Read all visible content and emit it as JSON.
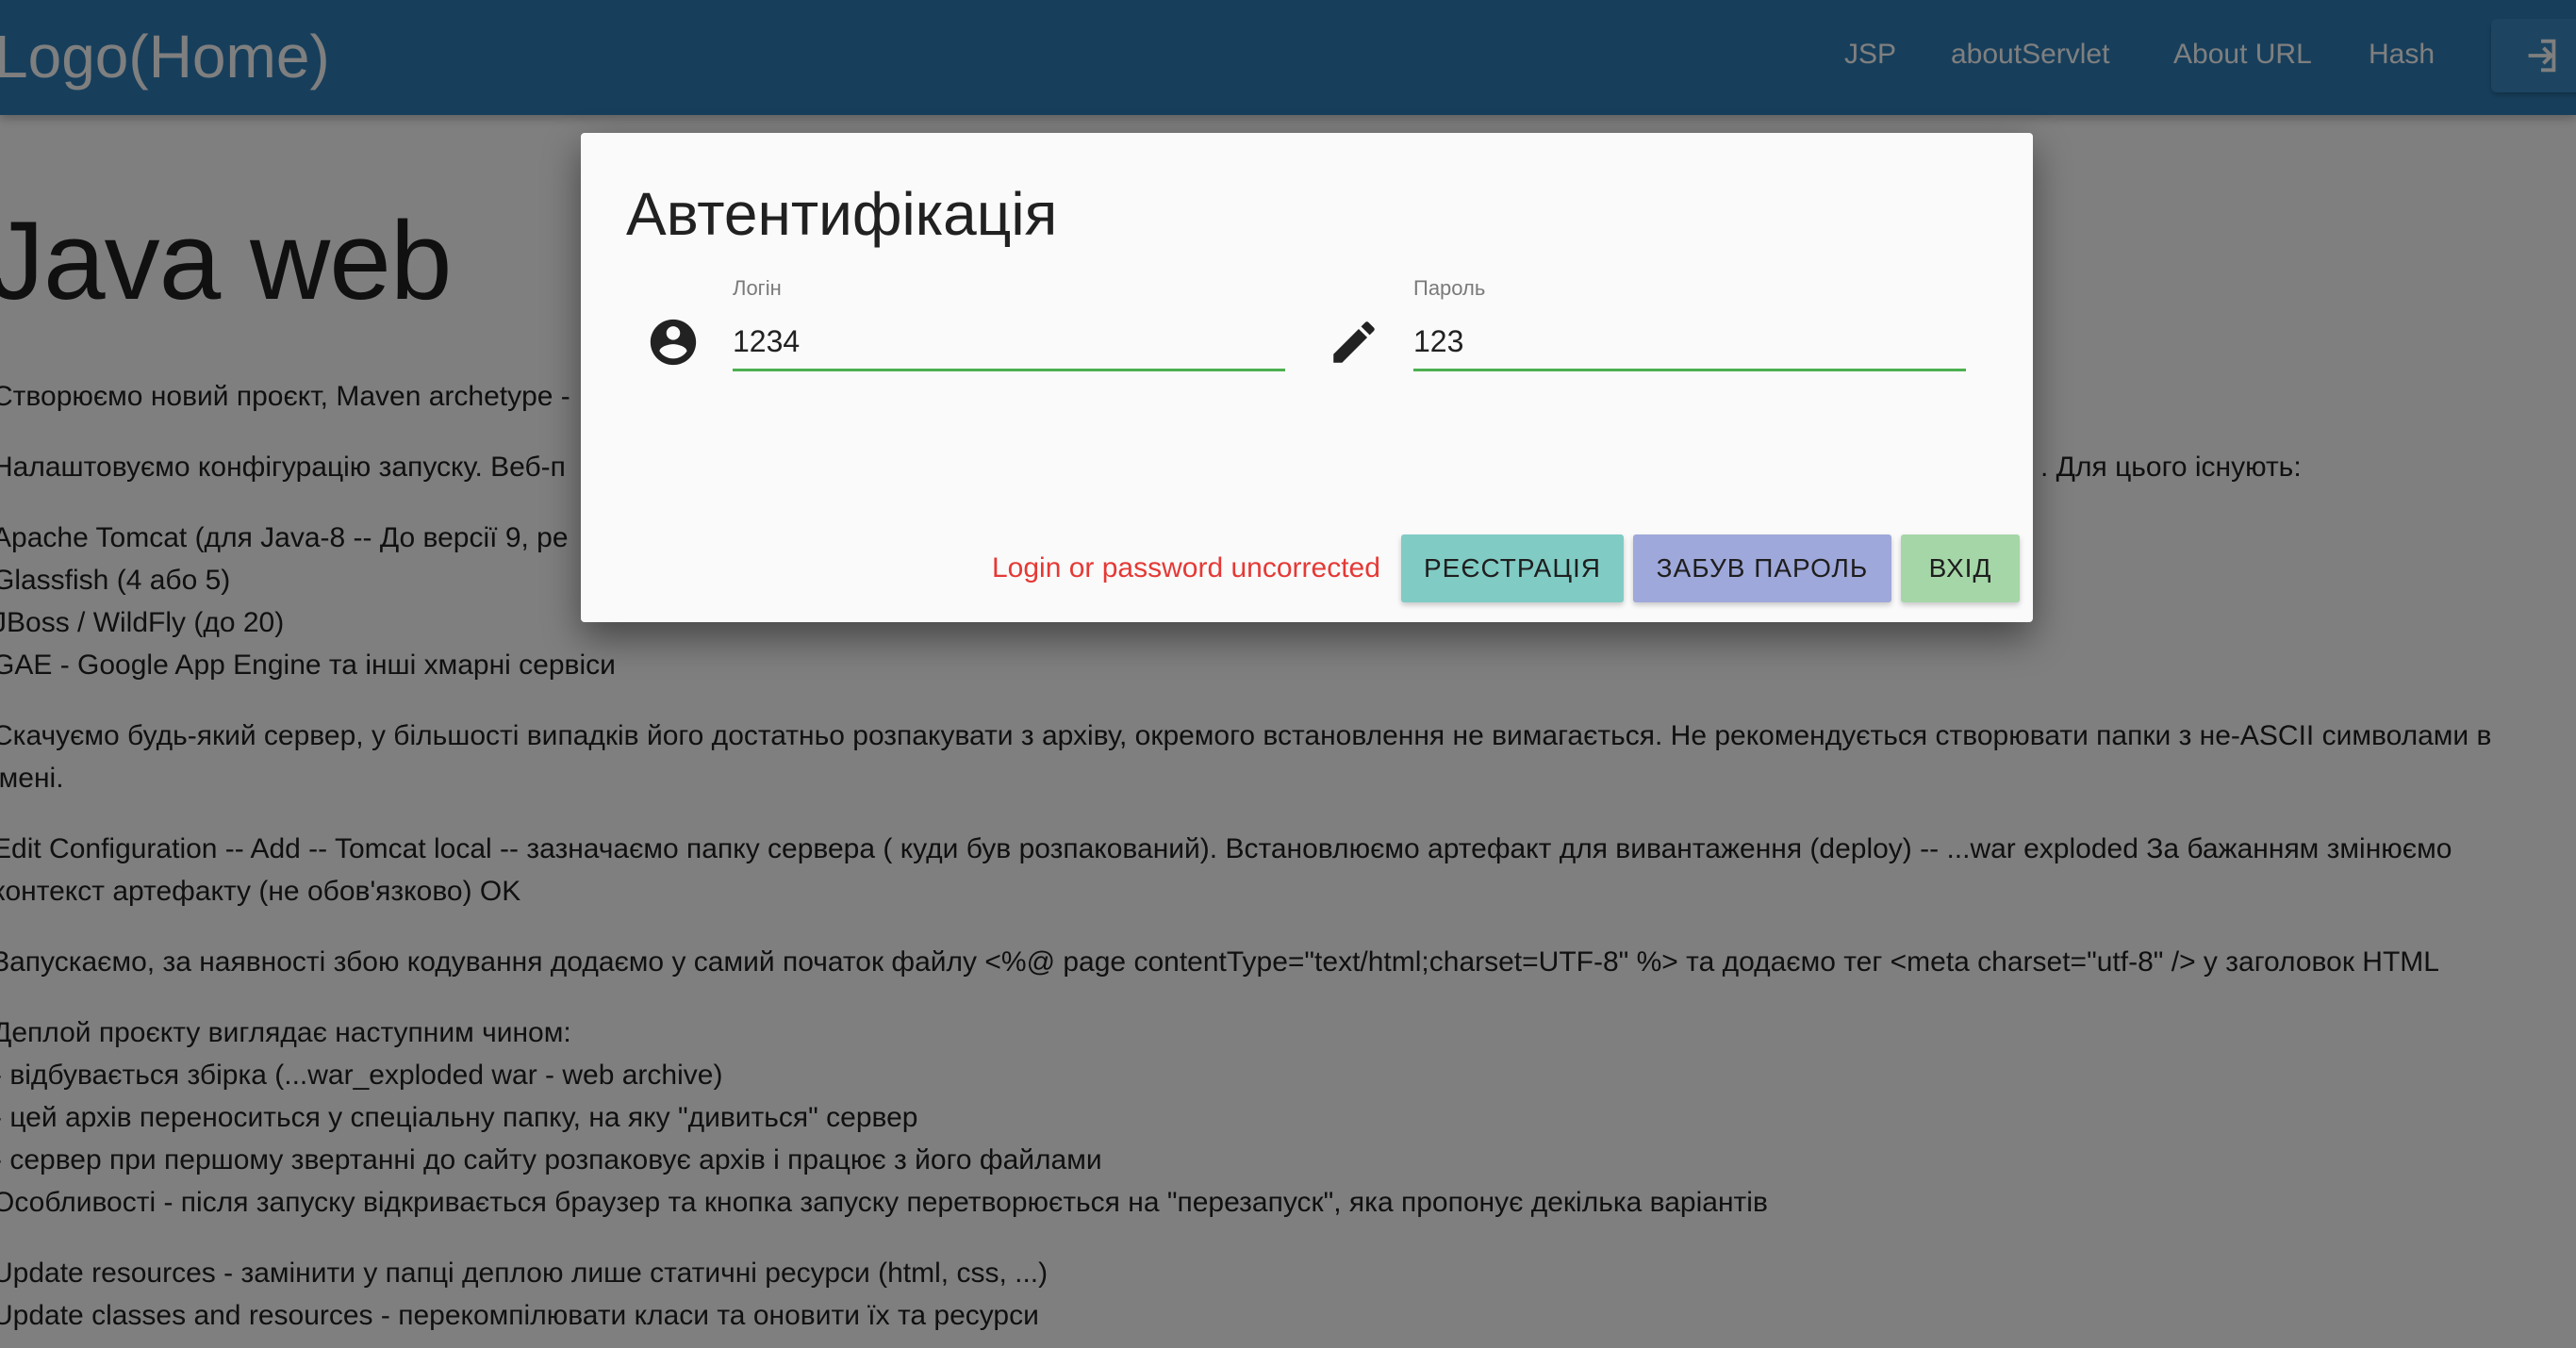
{
  "navbar": {
    "logo": "Logo(Home)",
    "links": [
      "JSP",
      "aboutServlet",
      "About URL",
      "Hash"
    ],
    "login_icon": "login-icon",
    "color": "#2f7fb9"
  },
  "content": {
    "heading": "Java web",
    "lines": [
      "Створюємо новий проєкт, Maven archetype -",
      "Налаштовуємо конфігурацію запуску. Веб-п",
      ". Для цього існують:",
      "Apache Tomcat (для Java-8 -- До версії 9, ре",
      "Glassfish (4 або 5)",
      "JBoss / WildFly (до 20)",
      "GAE - Google App Engine та інші хмарні сервіси",
      "Скачуємо будь-який сервер, у більшості випадків його достатньо розпакувати з архіву, окремого встановлення не вимагається. Не рекомендується створювати папки з не-ASCII символами в",
      "імені.",
      "Edit Configuration -- Add -- Tomcat local -- зазначаємо папку сервера ( куди був розпакований). Встановлюємо артефакт для вивантаження (deploy) -- ...war exploded За бажанням змінюємо",
      "контекст артефакту (не обов'язково) OK",
      "Запускаємо, за наявності збою кодування додаємо у самий початок файлу <%@ page contentType=\"text/html;charset=UTF-8\" %> та додаємо тег <meta charset=\"utf-8\" /> у заголовок HTML",
      "Деплой проєкту виглядає наступним чином:",
      "- відбувається збірка (...war_exploded war - web archive)",
      "- цей архів переноситься у спеціальну папку, на яку \"дивиться\" сервер",
      "- сервер при першому звертанні до сайту розпаковує архів і працює з його файлами",
      "Особливості - після запуску відкривається браузер та кнопка запуску перетворюється на \"перезапуск\", яка пропонує декілька варіантів",
      "Update resources - замінити у папці деплою лише статичні ресурси (html, css, ...)",
      "Update classes and resources - перекомпілювати класи та оновити їх та ресурси"
    ]
  },
  "modal": {
    "title": "Автентифікація",
    "login": {
      "label": "Логін",
      "value": "1234",
      "icon": "account-circle-icon"
    },
    "password": {
      "label": "Пароль",
      "value": "123",
      "icon": "pencil-icon"
    },
    "error": "Login or password uncorrected",
    "buttons": {
      "register": "Реєстрація",
      "forgot": "Забув пароль",
      "enter": "Вхід"
    },
    "colors": {
      "register": "#80cbc4",
      "forgot": "#9fa8da",
      "enter": "#a5d6a7",
      "error": "#e53935",
      "underline": "#4caf50"
    }
  }
}
